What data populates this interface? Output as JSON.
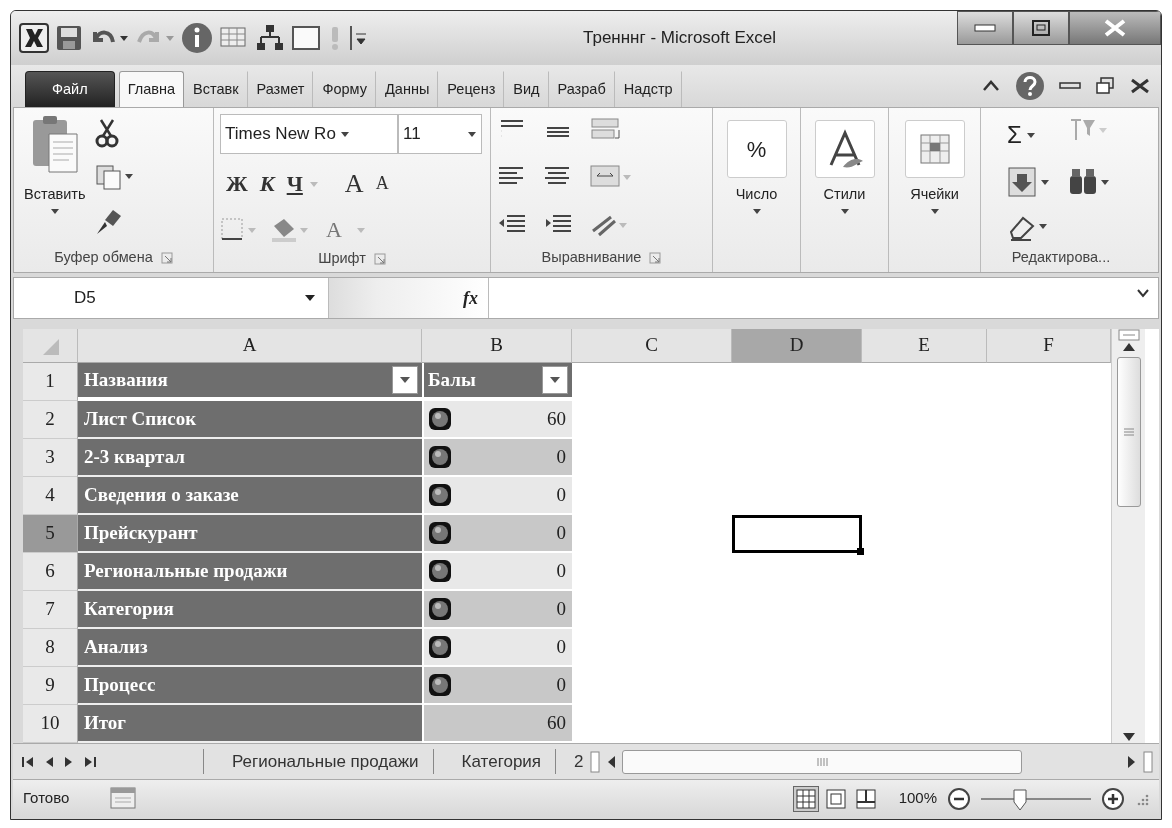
{
  "window": {
    "title": "Тренннг  -  Microsoft Excel"
  },
  "ribbon_tabs": [
    {
      "label": "Файл",
      "kind": "file",
      "selected": false
    },
    {
      "label": "Главна",
      "kind": "tab",
      "selected": true
    },
    {
      "label": "Вставк",
      "kind": "tab",
      "selected": false
    },
    {
      "label": "Размет",
      "kind": "tab",
      "selected": false
    },
    {
      "label": "Форму",
      "kind": "tab",
      "selected": false
    },
    {
      "label": "Данны",
      "kind": "tab",
      "selected": false
    },
    {
      "label": "Реценз",
      "kind": "tab",
      "selected": false
    },
    {
      "label": "Вид",
      "kind": "tab",
      "selected": false
    },
    {
      "label": "Разраб",
      "kind": "tab",
      "selected": false
    },
    {
      "label": "Надстр",
      "kind": "tab",
      "selected": false
    }
  ],
  "clipboard": {
    "paste_label": "Вставить",
    "group_label": "Буфер обмена"
  },
  "font": {
    "font_name": "Times New Ro",
    "font_size": "11",
    "bold": "Ж",
    "italic": "К",
    "underline": "Ч",
    "grow": "A",
    "shrink": "A",
    "font_color": "A",
    "group_label": "Шрифт"
  },
  "alignment": {
    "group_label": "Выравнивание"
  },
  "big_buttons": [
    {
      "label": "Число",
      "glyph": "%"
    },
    {
      "label": "Стили"
    },
    {
      "label": "Ячейки"
    }
  ],
  "editing": {
    "sum": "Σ",
    "group_label": "Редактирова..."
  },
  "formula_bar": {
    "name_box": "D5",
    "fx": "fx"
  },
  "columns": [
    {
      "label": "A",
      "selected": false
    },
    {
      "label": "B",
      "selected": false
    },
    {
      "label": "C",
      "selected": false
    },
    {
      "label": "D",
      "selected": true
    },
    {
      "label": "E",
      "selected": false
    },
    {
      "label": "F",
      "selected": false
    }
  ],
  "rows": [
    {
      "number": "1",
      "kind": "header",
      "selected": false,
      "name": "Названия",
      "value": "Балы"
    },
    {
      "number": "2",
      "kind": "item",
      "selected": false,
      "name": "Лист Список",
      "value": "60"
    },
    {
      "number": "3",
      "kind": "item",
      "selected": false,
      "name": "2-3 квартал",
      "value": "0"
    },
    {
      "number": "4",
      "kind": "item",
      "selected": false,
      "name": "Сведения о заказе",
      "value": "0"
    },
    {
      "number": "5",
      "kind": "item",
      "selected": true,
      "name": "Прейскурант",
      "value": "0"
    },
    {
      "number": "6",
      "kind": "item",
      "selected": false,
      "name": "Региональные продажи",
      "value": "0"
    },
    {
      "number": "7",
      "kind": "item",
      "selected": false,
      "name": "Категория",
      "value": "0"
    },
    {
      "number": "8",
      "kind": "item",
      "selected": false,
      "name": "Анализ",
      "value": "0"
    },
    {
      "number": "9",
      "kind": "item",
      "selected": false,
      "name": "Процесс",
      "value": "0"
    },
    {
      "number": "10",
      "kind": "total",
      "selected": false,
      "name": "Итог",
      "value": "60"
    }
  ],
  "sheet_tabs": [
    {
      "label": "Региональные продажи",
      "selected": false
    },
    {
      "label": "Категория",
      "selected": false
    },
    {
      "label": "2",
      "selected": false
    }
  ],
  "status_bar": {
    "status": "Готово",
    "zoom": "100%",
    "view_buttons": [
      {
        "kind": "normal",
        "selected": true
      },
      {
        "kind": "layout",
        "selected": false
      },
      {
        "kind": "pagebreak",
        "selected": false
      }
    ],
    "zoom_slider": {
      "level": 0.35
    }
  }
}
